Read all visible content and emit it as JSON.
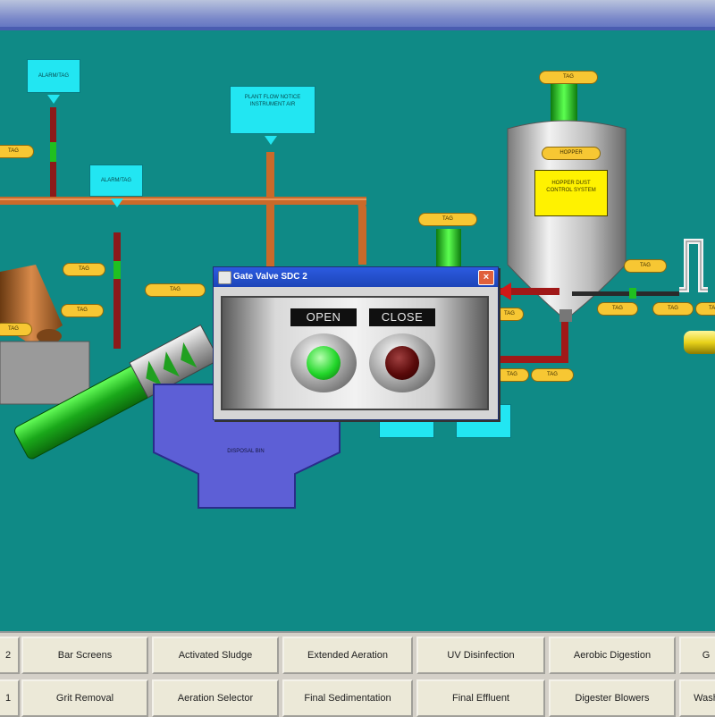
{
  "popup": {
    "title": "Gate Valve SDC 2",
    "open_label": "OPEN",
    "close_label": "CLOSE",
    "close_glyph": "×",
    "open_lamp_color": "#22d62a",
    "close_lamp_color": "#5a0a0a"
  },
  "labels": {
    "cyan_top_left": "ALARM/TAG",
    "cyan_mid_left": "ALARM/TAG",
    "cyan_center": "PLANT FLOW NOTICE INSTRUMENT AIR",
    "hopper_sign": "HOPPER DUST CONTROL SYSTEM",
    "hopper_tag": "HOPPER",
    "disposal_bin": "DISPOSAL BIN"
  },
  "tags": [
    "TAG",
    "TAG",
    "TAG",
    "TAG",
    "TAG",
    "TAG",
    "TAG",
    "TAG",
    "TAG",
    "TAG",
    "TAG",
    "TAG",
    "TAG",
    "TAG"
  ],
  "colors": {
    "background": "#0f8a86",
    "pipe_orange": "#c96a2a",
    "pipe_red": "#8c1a1a",
    "pipe_green": "#26c526",
    "tag_yellow": "#f7c733",
    "label_cyan": "#22e6f2",
    "bin_blue": "#5d5fd6"
  },
  "nav": {
    "row1": [
      "2",
      "Bar Screens",
      "Activated Sludge",
      "Extended Aeration",
      "UV Disinfection",
      "Aerobic Digestion",
      "G"
    ],
    "row2": [
      "1",
      "Grit Removal",
      "Aeration Selector",
      "Final Sedimentation",
      "Final Effluent",
      "Digester Blowers",
      "Wash"
    ]
  }
}
